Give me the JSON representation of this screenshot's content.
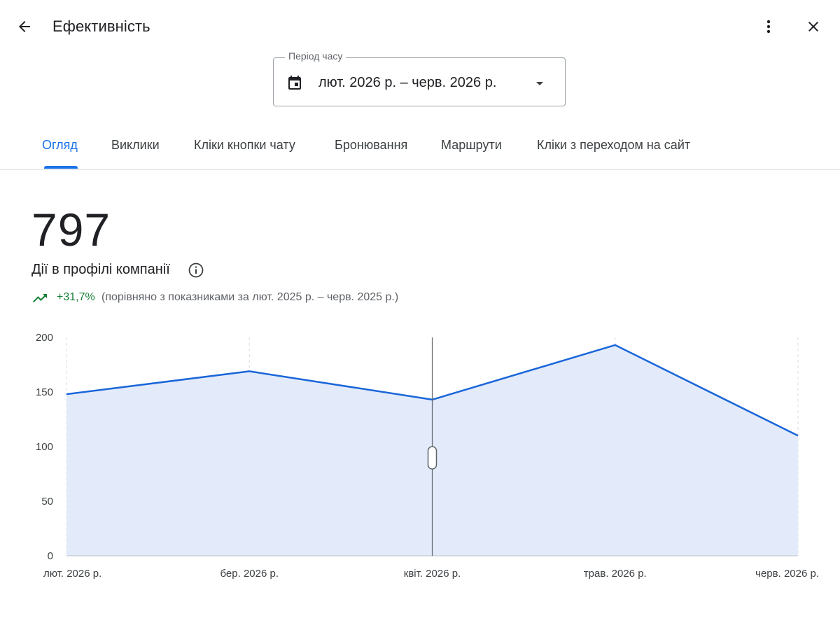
{
  "header": {
    "title": "Ефективність",
    "back_icon": "arrow-back-icon",
    "more_icon": "more-vert-icon",
    "close_icon": "close-icon"
  },
  "period": {
    "label": "Період часу",
    "value": "лют. 2026 р. – черв. 2026 р.",
    "icon": "calendar-icon",
    "caret_icon": "dropdown-caret-icon"
  },
  "tabs": [
    {
      "label": "Огляд",
      "active": true
    },
    {
      "label": "Виклики",
      "active": false
    },
    {
      "label": "Кліки кнопки чату",
      "active": false
    },
    {
      "label": "Бронювання",
      "active": false
    },
    {
      "label": "Маршрути",
      "active": false
    },
    {
      "label": "Кліки з переходом на сайт",
      "active": false
    }
  ],
  "metric": {
    "value": "797",
    "label": "Дії в профілі компанії",
    "info_icon": "info-icon",
    "trend_icon": "trending-up-icon",
    "trend_pct": "+31,7%",
    "trend_compare": "(порівняно з показниками за лют. 2025 р. – черв. 2025 р.)"
  },
  "colors": {
    "accent": "#1a73e8",
    "line": "#1a66d9",
    "area": "#e3ebfa",
    "positive": "#188038"
  },
  "chart_data": {
    "type": "area",
    "categories": [
      "лют. 2026 р.",
      "бер. 2026 р.",
      "квіт. 2026 р.",
      "трав. 2026 р.",
      "черв. 2026 р."
    ],
    "values": [
      148,
      169,
      143,
      193,
      110
    ],
    "ylim": [
      0,
      200
    ],
    "yticks": [
      0,
      50,
      100,
      150,
      200
    ],
    "grid": "vertical dashed",
    "cursor_category": "квіт. 2026 р."
  }
}
